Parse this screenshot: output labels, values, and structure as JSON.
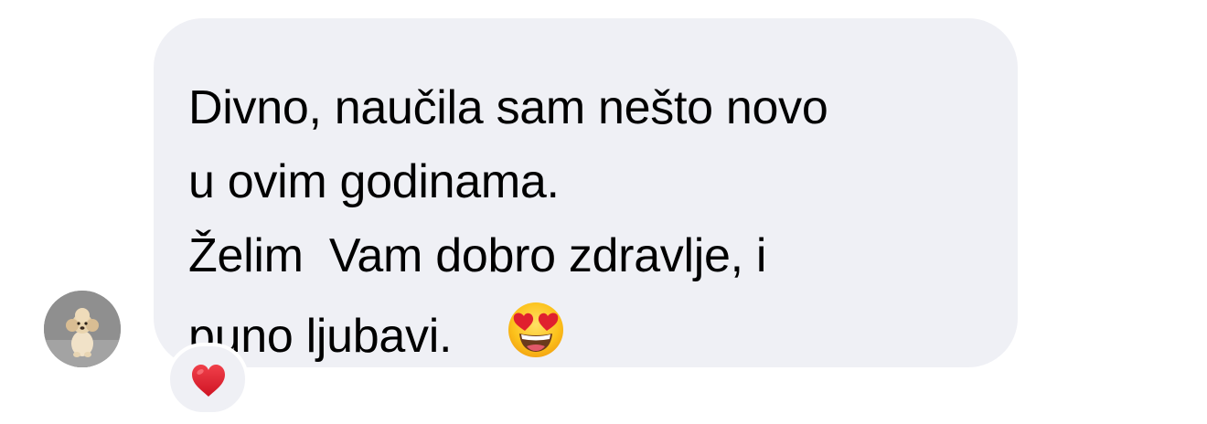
{
  "message": {
    "lines": [
      "Divno, naučila sam nešto novo",
      "u ovim godinama.",
      "Želim  Vam dobro zdravlje, i",
      "puno ljubavi."
    ],
    "emoji": "smiling-face-with-heart-eyes"
  },
  "reaction": {
    "emoji": "red-heart"
  },
  "colors": {
    "bubble": "#eff0f5",
    "text": "#000000",
    "heart": "#e0202e"
  }
}
